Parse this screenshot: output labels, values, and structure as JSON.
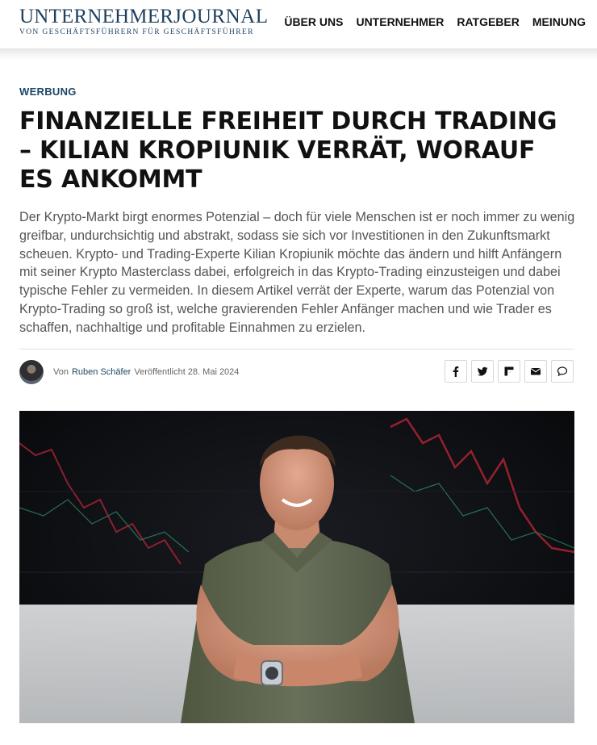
{
  "header": {
    "logo_main_a": "UNTERNEHMER",
    "logo_main_b": "JOURNAL",
    "logo_sub": "VON GESCHÄFTSFÜHRERN FÜR GESCHÄFTSFÜHRER",
    "nav": [
      "ÜBER UNS",
      "UNTERNEHMER",
      "RATGEBER",
      "MEINUNG"
    ]
  },
  "article": {
    "category": "WERBUNG",
    "title": "FINANZIELLE FREIHEIT DURCH TRADING – KILIAN KROPIUNIK VERRÄT, WORAUF ES ANKOMMT",
    "lead": "Der Krypto-Markt birgt enormes Potenzial – doch für viele Menschen ist er noch immer zu wenig greifbar, undurchsichtig und abstrakt, sodass sie sich vor Investitionen in den Zukunftsmarkt scheuen. Krypto- und Trading-Experte Kilian Kropiunik möchte das ändern und hilft Anfängern mit seiner Krypto Masterclass dabei, erfolgreich in das Krypto-Trading einzusteigen und dabei typische Fehler zu vermeiden. In diesem Artikel verrät der Experte, warum das Potenzial von Krypto-Trading so groß ist, welche gravierenden Fehler Anfänger machen und wie Trader es schaffen, nachhaltige und profitable Einnahmen zu erzielen.",
    "byline_prefix": "Von",
    "author": "Ruben Schäfer",
    "published": "Veröffentlicht 28. Mai 2024"
  },
  "share": {
    "icons": [
      "facebook-icon",
      "twitter-icon",
      "flipboard-icon",
      "email-icon",
      "comment-icon"
    ]
  },
  "colors": {
    "brand": "#1c3f5e",
    "accent": "#1c4766"
  }
}
